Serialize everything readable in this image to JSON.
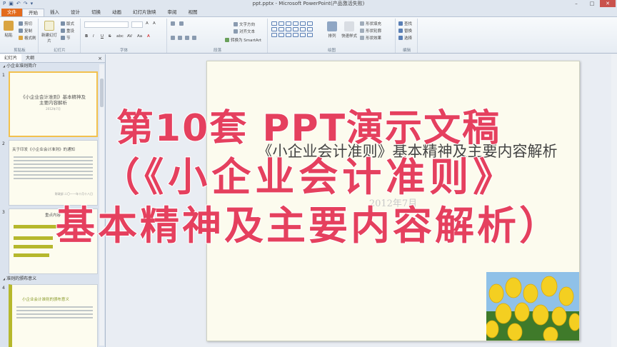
{
  "titlebar": {
    "title": "ppt.pptx - Microsoft PowerPoint(产品激活失败)",
    "qat": [
      "P",
      "▣",
      "↶",
      "↷",
      "▾"
    ],
    "minimize": "–",
    "maximize": "□",
    "close": "✕"
  },
  "tabs": [
    "文件",
    "开始",
    "插入",
    "设计",
    "切换",
    "动画",
    "幻灯片放映",
    "审阅",
    "视图"
  ],
  "ribbon": {
    "clipboard": {
      "label": "剪贴板",
      "paste": "粘贴",
      "cut": "剪切",
      "copy": "复制",
      "format_painter": "格式刷"
    },
    "slides": {
      "label": "幻灯片",
      "new_slide": "新建幻灯片",
      "layout": "版式",
      "reset": "重设",
      "section": "节"
    },
    "font": {
      "label": "字体",
      "bold": "B",
      "italic": "I",
      "underline": "U",
      "strike": "S",
      "shadow": "abc",
      "spacing": "AV",
      "case": "Aa",
      "color": "A",
      "grow": "A",
      "shrink": "A"
    },
    "paragraph": {
      "label": "段落",
      "text_direction": "文字方向",
      "align_text": "对齐文本",
      "smartart": "转换为 SmartArt"
    },
    "drawing": {
      "label": "绘图",
      "arrange": "排列",
      "quick_styles": "快速样式",
      "fill": "形状填充",
      "outline": "形状轮廓",
      "effects": "形状效果"
    },
    "editing": {
      "label": "编辑",
      "find": "查找",
      "replace": "替换",
      "select": "选择"
    }
  },
  "panel": {
    "tabs": [
      "幻灯片",
      "大纲"
    ],
    "close": "×",
    "section1": "小企业准则简介",
    "section2": "准则的颁布意义",
    "slides": [
      {
        "num": "1",
        "title": "《小企业会计准则》基本精神及主要内容解析",
        "date": "2012年7月"
      },
      {
        "num": "2",
        "title": "关于印发《小企业会计准则》的通知",
        "footer": "财政部 二〇一一年十月十八日"
      },
      {
        "num": "3",
        "title": "重点内容"
      },
      {
        "num": "4",
        "title": "小企业会计准则的颁布意义"
      }
    ]
  },
  "slide": {
    "title": "《小企业会计准则》基本精神及主要内容解析",
    "date": "2012年7月"
  },
  "overlay": {
    "line1": "第10套 PPT演示文稿",
    "line2": "（《小企业会计准则》",
    "line3": "基本精神及主要内容解析）"
  }
}
